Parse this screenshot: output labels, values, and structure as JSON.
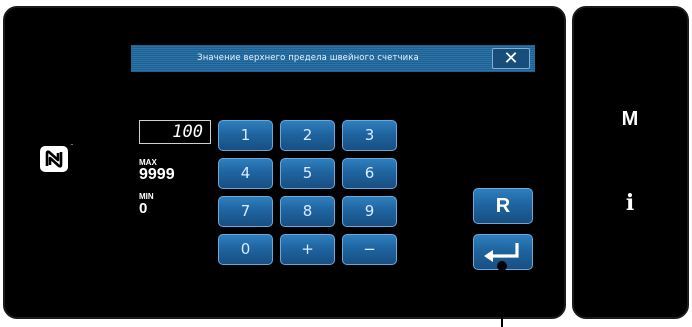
{
  "dialog": {
    "title": "Значение верхнего предела швейного счетчика",
    "close_label": "✕"
  },
  "input": {
    "value": "100",
    "max_label": "MAX",
    "max_value": "9999",
    "min_label": "MIN",
    "min_value": "0"
  },
  "keypad": {
    "keys": [
      "1",
      "2",
      "3",
      "4",
      "5",
      "6",
      "7",
      "8",
      "9",
      "0",
      "+",
      "−"
    ]
  },
  "actions": {
    "reset_label": "R",
    "enter_icon": "enter-arrow-icon"
  },
  "side": {
    "menu_label": "M",
    "info_label": "i"
  },
  "colors": {
    "key_blue": "#1f64a0",
    "header_blue": "#2a74aa",
    "panel": "#000000"
  }
}
